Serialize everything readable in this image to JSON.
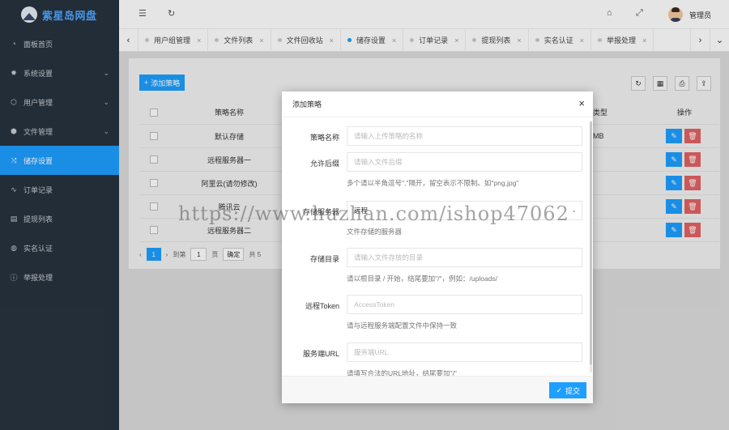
{
  "app": {
    "title": "紫星岛网盘"
  },
  "sidebar": {
    "items": [
      {
        "label": "面板首页",
        "icon": "dashboard-icon",
        "glyph": "◔",
        "has_arrow": false
      },
      {
        "label": "系统设置",
        "icon": "gear-icon",
        "glyph": "✹",
        "has_arrow": true
      },
      {
        "label": "用户管理",
        "icon": "user-cube-icon",
        "glyph": "⬡",
        "has_arrow": true
      },
      {
        "label": "文件管理",
        "icon": "file-stack-icon",
        "glyph": "⬢",
        "has_arrow": true
      },
      {
        "label": "储存设置",
        "icon": "shuffle-icon",
        "glyph": "⤨",
        "has_arrow": false,
        "active": true
      },
      {
        "label": "订单记录",
        "icon": "pulse-icon",
        "glyph": "∿",
        "has_arrow": false
      },
      {
        "label": "提现列表",
        "icon": "list-icon",
        "glyph": "▤",
        "has_arrow": false
      },
      {
        "label": "实名认证",
        "icon": "shield-check-icon",
        "glyph": "◍",
        "has_arrow": false
      },
      {
        "label": "举报处理",
        "icon": "info-circle-icon",
        "glyph": "ⓘ",
        "has_arrow": false
      }
    ]
  },
  "header": {
    "menu_icon": "☰",
    "refresh_icon": "↻",
    "home_icon": "⌂",
    "fullscreen_icon": "⤢",
    "user_name": "管理员"
  },
  "tabs": {
    "prev": "‹",
    "next": "›",
    "dropdown": "⌄",
    "items": [
      {
        "label": "用户组管理",
        "active": false
      },
      {
        "label": "文件列表",
        "active": false
      },
      {
        "label": "文件回收站",
        "active": false
      },
      {
        "label": "储存设置",
        "active": true
      },
      {
        "label": "订单记录",
        "active": false
      },
      {
        "label": "提现列表",
        "active": false
      },
      {
        "label": "实名认证",
        "active": false
      },
      {
        "label": "举报处理",
        "active": false
      }
    ],
    "close_glyph": "×"
  },
  "toolbar": {
    "add_label": "添加策略",
    "add_glyph": "+",
    "refresh_glyph": "↻",
    "columns_glyph": "▦",
    "print_glyph": "⎙",
    "export_glyph": "⇪"
  },
  "table": {
    "headers": {
      "name": "策略名称",
      "type": "类型",
      "op": "操作"
    },
    "rows": [
      {
        "name": "默认存储",
        "type": "MB"
      },
      {
        "name": "远程服务器一",
        "type": ""
      },
      {
        "name": "阿里云(请勿修改)",
        "type": ""
      },
      {
        "name": "腾讯云",
        "type": ""
      },
      {
        "name": "远程服务器二",
        "type": ""
      }
    ],
    "edit_glyph": "✎",
    "delete_glyph": "🗑"
  },
  "pager": {
    "prev": "‹",
    "current": "1",
    "next": "›",
    "goto_label": "到第",
    "page_input": "1",
    "page_unit": "页",
    "confirm": "确定",
    "total_prefix": "共 5"
  },
  "modal": {
    "title": "添加策略",
    "close": "×",
    "fields": [
      {
        "label": "策略名称",
        "placeholder": "请输入上传策略的名称",
        "value": "",
        "help": ""
      },
      {
        "label": "允许后缀",
        "placeholder": "请输入文件后缀",
        "value": "",
        "help": "多个请以半角逗号\",\"隔开，留空表示不限制。如\"png,jpg\""
      },
      {
        "label": "存储服务器",
        "placeholder": "",
        "value": "远程",
        "help": "文件存储的服务器",
        "select": true,
        "arrow": "⌄"
      },
      {
        "label": "存储目录",
        "placeholder": "请输入文件存放的目录",
        "value": "",
        "help": "请以根目录 / 开始，结尾要加\"/\"，例如：/uploads/"
      },
      {
        "label": "远程Token",
        "placeholder": "AccessToken",
        "value": "",
        "help": "请与远程服务端配置文件中保持一致"
      },
      {
        "label": "服务端URL",
        "placeholder": "服务端URL",
        "value": "",
        "help": "请填写合法的URL地址，结尾要加\"/\""
      }
    ],
    "submit_label": "提交",
    "submit_glyph": "✓"
  },
  "watermark": "https://www.huzhan.com/ishop47062",
  "colors": {
    "sidebar_bg": "#28333e",
    "accent": "#1e9fff",
    "danger": "#e36363"
  }
}
